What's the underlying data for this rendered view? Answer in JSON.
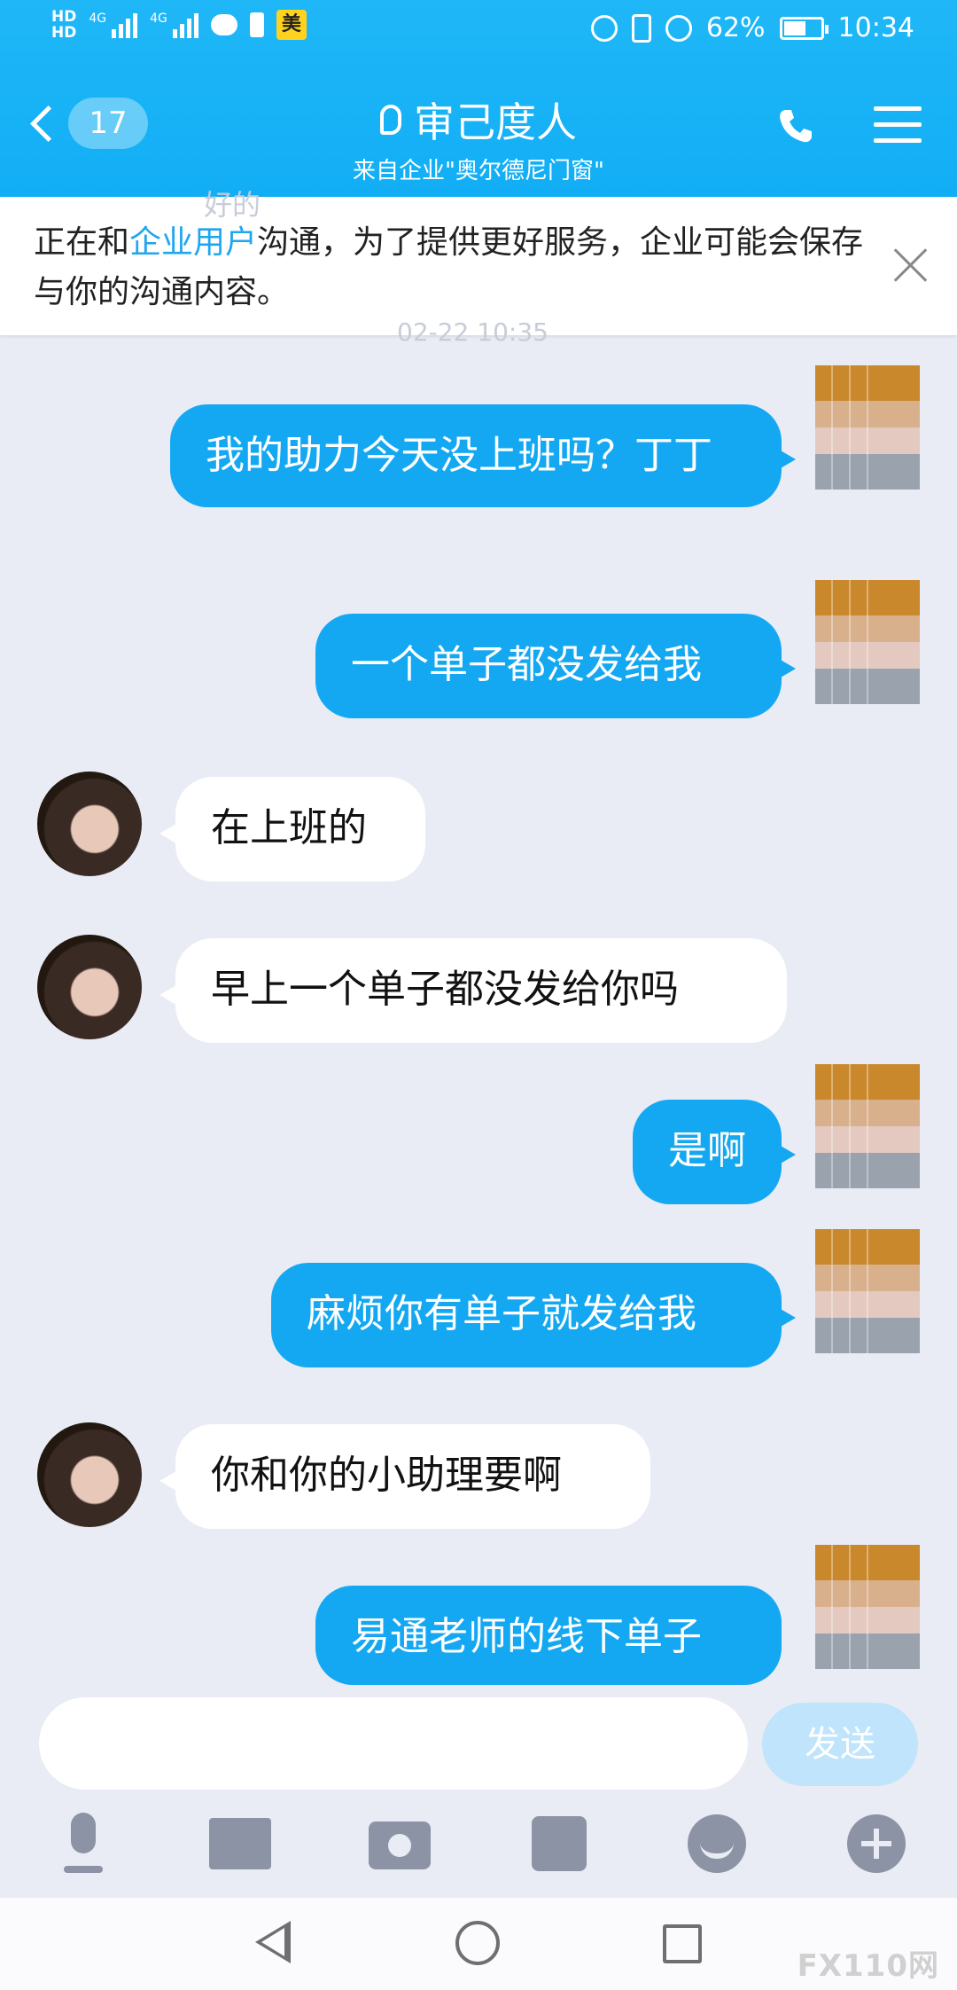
{
  "status_bar": {
    "battery": "62%",
    "time": "10:34",
    "battery_level": 0.62,
    "network": "4G",
    "hd": "HD",
    "app_badge": "美"
  },
  "header": {
    "back_count": "17",
    "title": "审己度人",
    "subtitle": "来自企业\"奥尔德尼门窗\""
  },
  "notice": {
    "text_before": "正在和",
    "highlight": "企业用户",
    "text_after": "沟通，为了提供更好服务，企业可能会保存与你的沟通内容。",
    "ghost_top": "好的",
    "ghost_time": "02-22 10:35"
  },
  "messages": [
    {
      "side": "right",
      "text": "我的助力今天没上班吗？丁丁"
    },
    {
      "side": "right",
      "text": "一个单子都没发给我"
    },
    {
      "side": "left",
      "text": "在上班的"
    },
    {
      "side": "left",
      "text": "早上一个单子都没发给你吗"
    },
    {
      "side": "right",
      "text": "是啊"
    },
    {
      "side": "right",
      "text": "麻烦你有单子就发给我"
    },
    {
      "side": "left",
      "text": "你和你的小助理要啊"
    },
    {
      "side": "right",
      "text": "易通老师的线下单子"
    }
  ],
  "input": {
    "placeholder": "",
    "send_label": "发送"
  },
  "watermark": "FX110网",
  "colors": {
    "accent": "#14a8f3",
    "header": "#1fb7f7",
    "background": "#e9ecf5"
  }
}
